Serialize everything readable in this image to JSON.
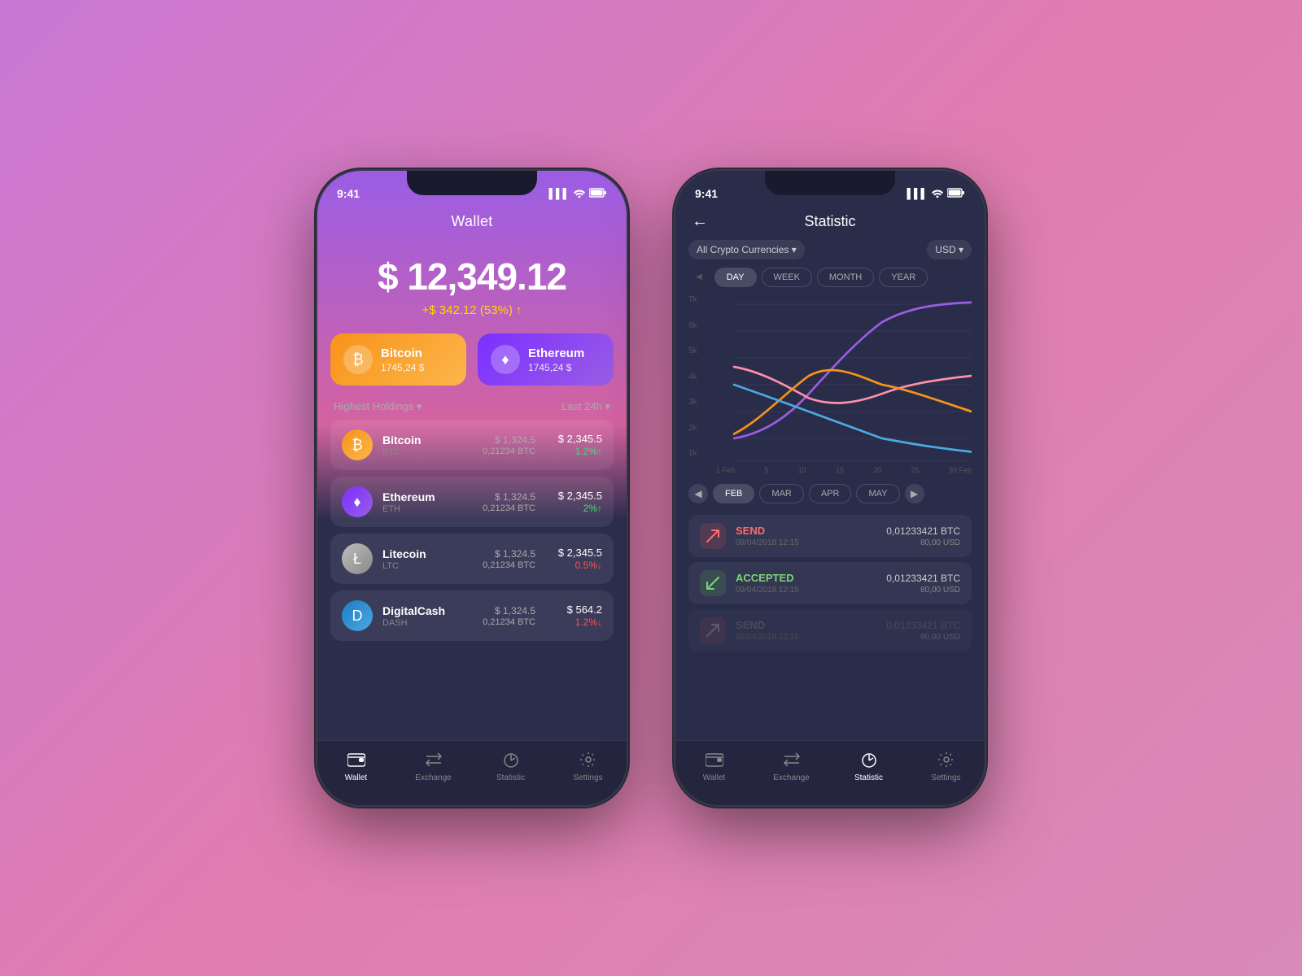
{
  "background": {
    "gradient": "linear-gradient(135deg, #c977d4 0%, #e07db0 50%, #d88ab8 100%)"
  },
  "phone_wallet": {
    "status_bar": {
      "time": "9:41",
      "signal": "▌▌▌",
      "wifi": "wifi",
      "battery": "battery"
    },
    "title": "Wallet",
    "balance": {
      "amount": "$ 12,349.12",
      "change": "+$ 342.12 (53%) ↑"
    },
    "top_cards": [
      {
        "name": "Bitcoin",
        "value": "1745,24 $",
        "icon": "₿",
        "color": "#f7931a"
      },
      {
        "name": "Ethereum",
        "value": "1745,24 $",
        "icon": "♦",
        "color": "#9b5de5"
      }
    ],
    "holdings_label": "Highest Holdings ▾",
    "period_label": "Last 24h ▾",
    "crypto_list": [
      {
        "name": "Bitcoin",
        "ticker": "BTC",
        "price": "$ 1,324.5",
        "btc_val": "0,21234 BTC",
        "usd": "$ 2,345.5",
        "change": "1.2%↑",
        "change_dir": "up",
        "icon": "₿",
        "icon_class": "icon-btc"
      },
      {
        "name": "Ethereum",
        "ticker": "ETH",
        "price": "$ 1,324.5",
        "btc_val": "0,21234 BTC",
        "usd": "$ 2,345.5",
        "change": "2%↑",
        "change_dir": "up",
        "icon": "♦",
        "icon_class": "icon-eth"
      },
      {
        "name": "Litecoin",
        "ticker": "LTC",
        "price": "$ 1,324.5",
        "btc_val": "0,21234 BTC",
        "usd": "$ 2,345.5",
        "change": "0.5%↓",
        "change_dir": "down",
        "icon": "Ł",
        "icon_class": "icon-ltc"
      },
      {
        "name": "DigitalCash",
        "ticker": "DASH",
        "price": "$ 1,324.5",
        "btc_val": "0,21234 BTC",
        "usd": "$ 564.2",
        "change": "1.2%↓",
        "change_dir": "down",
        "icon": "D",
        "icon_class": "icon-dash"
      }
    ],
    "bottom_nav": [
      {
        "label": "Wallet",
        "active": true
      },
      {
        "label": "Exchange",
        "active": false
      },
      {
        "label": "Statistic",
        "active": false
      },
      {
        "label": "Settings",
        "active": false
      }
    ]
  },
  "phone_statistic": {
    "status_bar": {
      "time": "9:41"
    },
    "title": "Statistic",
    "back_label": "←",
    "filter_crypto": "All Crypto Currencies ▾",
    "filter_currency": "USD ▾",
    "time_tabs": [
      "DAY",
      "WEEK",
      "MONTH",
      "YEAR"
    ],
    "active_time_tab": "DAY",
    "chart": {
      "y_labels": [
        "7k",
        "6k",
        "5k",
        "4k",
        "3k",
        "2k",
        "1k"
      ],
      "x_labels": [
        "1 Feb",
        "5",
        "10",
        "15",
        "20",
        "25",
        "30 Feb"
      ]
    },
    "month_tabs": [
      "FEB",
      "MAR",
      "APR",
      "MAY"
    ],
    "active_month_tab": "FEB",
    "transactions": [
      {
        "type": "SEND",
        "date": "09/04/2018 12:15",
        "btc": "0,01233421 BTC",
        "usd": "80,00 USD",
        "kind": "send"
      },
      {
        "type": "ACCEPTED",
        "date": "09/04/2018 12:15",
        "btc": "0,01233421 BTC",
        "usd": "80,00 USD",
        "kind": "accept"
      },
      {
        "type": "SEND",
        "date": "09/04/2018 12:15",
        "btc": "0,01233421 BTC",
        "usd": "80,00 USD",
        "kind": "send_dimmed"
      }
    ],
    "bottom_nav": [
      {
        "label": "Wallet",
        "active": false
      },
      {
        "label": "Exchange",
        "active": false
      },
      {
        "label": "Statistic",
        "active": true
      },
      {
        "label": "Settings",
        "active": false
      }
    ]
  }
}
